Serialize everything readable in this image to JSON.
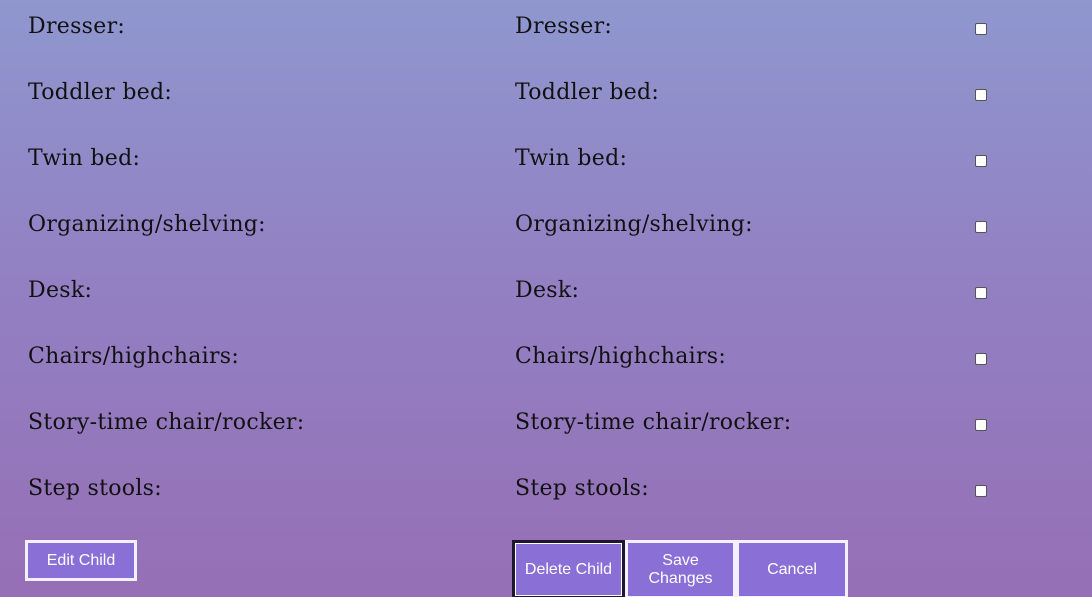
{
  "left_labels": [
    "Dresser:",
    "Toddler bed:",
    "Twin bed:",
    "Organizing/shelving:",
    "Desk:",
    "Chairs/highchairs:",
    "Story-time chair/rocker:",
    "Step stools:"
  ],
  "right_labels": [
    "Dresser:",
    "Toddler bed:",
    "Twin bed:",
    "Organizing/shelving:",
    "Desk:",
    "Chairs/highchairs:",
    "Story-time chair/rocker:",
    "Step stools:"
  ],
  "checkboxes": [
    false,
    false,
    false,
    false,
    false,
    false,
    false,
    false
  ],
  "buttons": {
    "edit_child": "Edit Child",
    "delete_child": "Delete Child",
    "save_changes": "Save Changes",
    "cancel": "Cancel"
  },
  "colors": {
    "button_bg": "#8a6fd6",
    "background_top": "#8f97cf",
    "background_bottom": "#966fb6"
  }
}
